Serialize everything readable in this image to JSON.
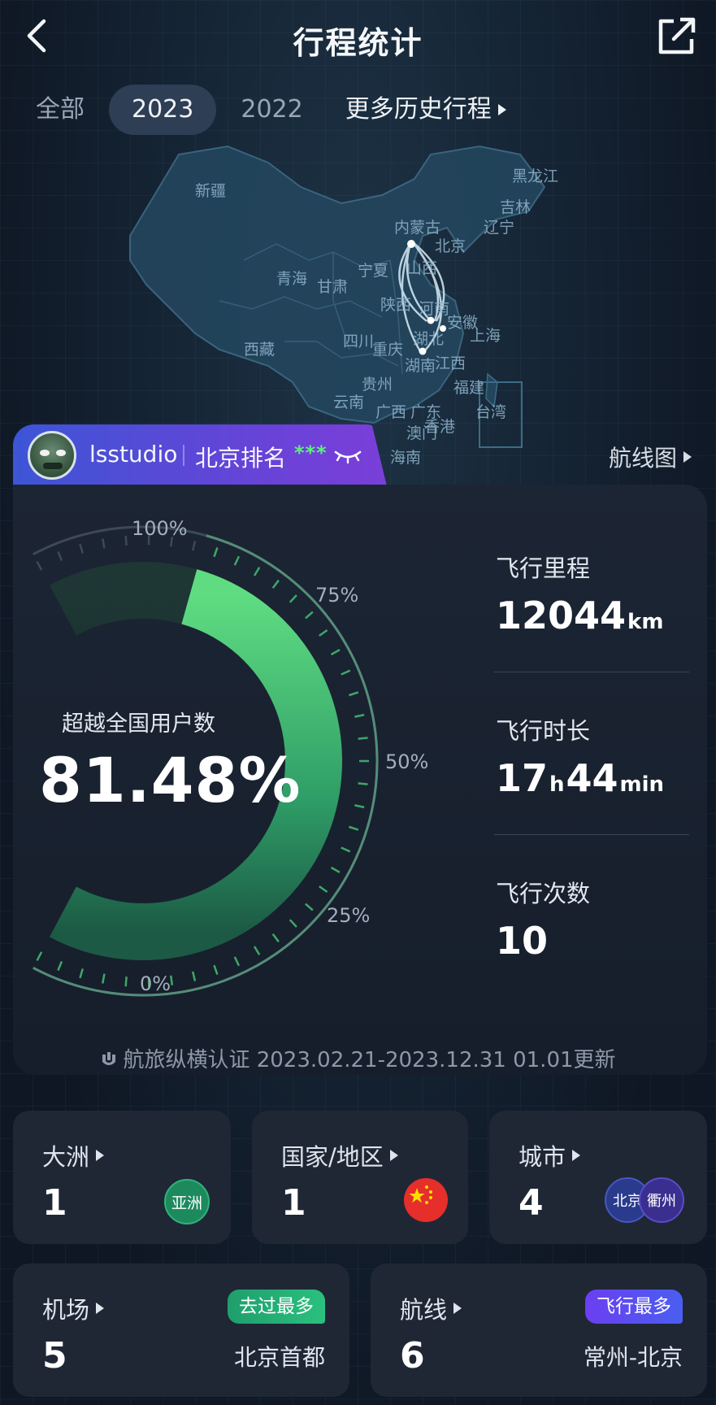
{
  "header": {
    "title": "行程统计"
  },
  "tabs": {
    "all": "全部",
    "y2023": "2023",
    "y2022": "2022",
    "more": "更多历史行程"
  },
  "map": {
    "provinces": [
      "新疆",
      "黑龙江",
      "吉林",
      "辽宁",
      "内蒙古",
      "北京",
      "青海",
      "甘肃",
      "宁夏",
      "山西",
      "陕西",
      "河南",
      "西藏",
      "四川",
      "重庆",
      "湖北",
      "安徽",
      "上海",
      "湖南",
      "江西",
      "贵州",
      "云南",
      "福建",
      "广西",
      "广东",
      "台湾",
      "香港",
      "澳门",
      "海南"
    ]
  },
  "ranking": {
    "username": "lsstudio",
    "label": "北京排名",
    "hidden": "***"
  },
  "route_map_link": "航线图",
  "gauge": {
    "ticks": [
      "100%",
      "75%",
      "50%",
      "25%",
      "0%"
    ],
    "beat_label": "超越全国用户数",
    "beat_value": "81.48%",
    "percent": 81.48
  },
  "stats": {
    "mileage": {
      "label": "飞行里程",
      "value": "12044",
      "unit": "km"
    },
    "duration": {
      "label": "飞行时长",
      "hours": "17",
      "h_unit": "h",
      "minutes": "44",
      "m_unit": "min"
    },
    "count": {
      "label": "飞行次数",
      "value": "10"
    }
  },
  "certification": "航旅纵横认证 2023.02.21-2023.12.31 01.01更新",
  "cards": {
    "continent": {
      "title": "大洲",
      "value": "1",
      "badge": "亚洲"
    },
    "country": {
      "title": "国家/地区",
      "value": "1"
    },
    "city": {
      "title": "城市",
      "value": "4",
      "badges": [
        "北京",
        "衢州"
      ]
    },
    "airport": {
      "title": "机场",
      "value": "5",
      "tag": "去过最多",
      "top": "北京首都"
    },
    "route": {
      "title": "航线",
      "value": "6",
      "tag": "飞行最多",
      "top": "常州-北京"
    }
  },
  "colors": {
    "accent_green": "#4fd67c",
    "pill_blue": "#3d55d6",
    "pill_purple": "#7a3fd8",
    "tag_purple": "#6b3ff0"
  }
}
